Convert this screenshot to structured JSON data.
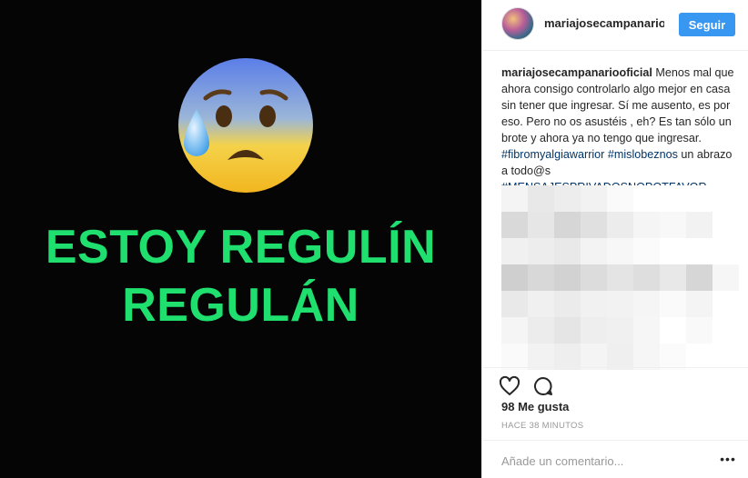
{
  "post": {
    "emoji": "anxious-face-with-sweat",
    "big_text_line1": "ESTOY REGULÍN",
    "big_text_line2": "REGULÁN",
    "big_text_color": "#1fe06f",
    "background_color": "#050505"
  },
  "header": {
    "username": "mariajosecampanariooficial",
    "follow_label": "Seguir",
    "follow_color": "#3897f0"
  },
  "comment": {
    "author": "mariajosecampanariooficial",
    "text": " Menos mal que ahora consigo controlarlo algo mejor en casa sin tener que ingresar. Sí me ausento, es por eso. Pero no os asustéis , eh? Es tan sólo un brote y ahora ya no tengo que ingresar. ",
    "tag1": "#fibromyalgiawarrior",
    "tag2": "#mislobeznos",
    "text2": " un abrazo a todo@s ",
    "tag3": "#MENSAJESPRIVADOSNOPOTFAVOR"
  },
  "actions": {
    "like_icon": "heart-outline-icon",
    "comment_icon": "speech-bubble-icon",
    "likes": "98 Me gusta",
    "timestamp": "HACE 38 MINUTOS"
  },
  "add_comment": {
    "placeholder": "Añade un comentario...",
    "more_icon": "more-options-icon"
  }
}
